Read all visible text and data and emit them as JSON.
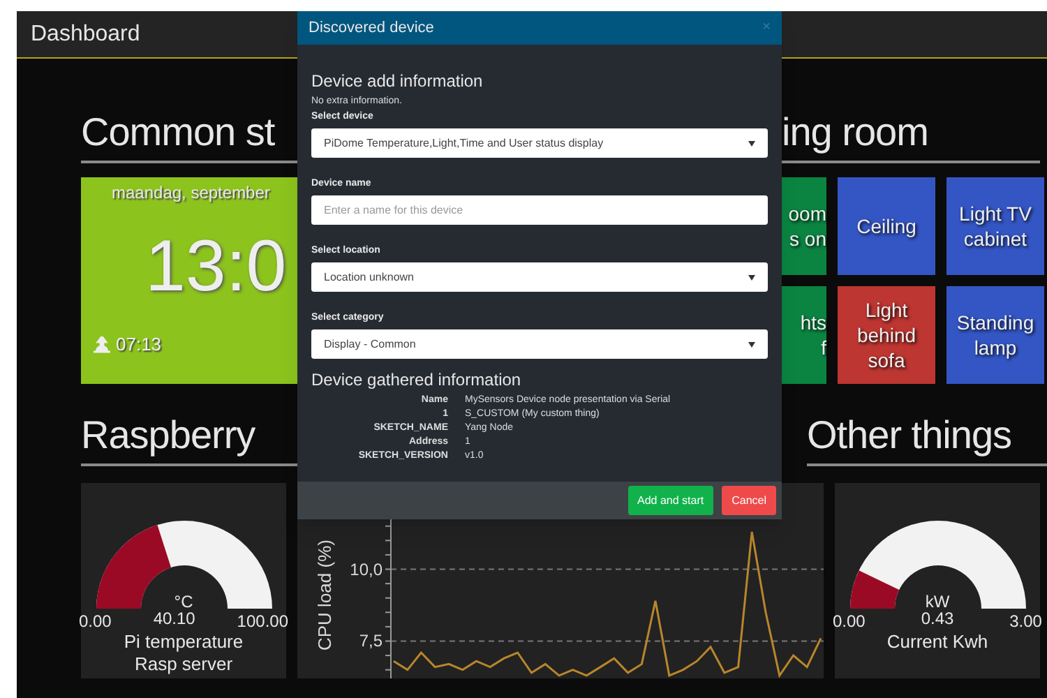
{
  "header": {
    "title": "Dashboard"
  },
  "common_section": {
    "title": "Common st",
    "clock": {
      "date": "maandag, september",
      "time": "13:0",
      "sunrise": "07:13"
    }
  },
  "living_room_section": {
    "title": "ing room",
    "tiles": [
      {
        "lines": [
          "oom",
          "s on"
        ],
        "color": "#0b8441",
        "partial": true
      },
      {
        "lines": [
          "Ceiling"
        ],
        "color": "#3456c4",
        "partial": false
      },
      {
        "lines": [
          "Light TV",
          "cabinet"
        ],
        "color": "#3456c4",
        "partial": false
      },
      {
        "lines": [
          "hts",
          "f"
        ],
        "color": "#0b8441",
        "partial": true
      },
      {
        "lines": [
          "Light",
          "behind",
          "sofa"
        ],
        "color": "#bd3631",
        "partial": false
      },
      {
        "lines": [
          "Standing",
          "lamp"
        ],
        "color": "#3456c4",
        "partial": false
      }
    ]
  },
  "raspberry_section": {
    "title": "Raspberry",
    "gauge": {
      "unit": "°C",
      "value": "40.10",
      "min": "0.00",
      "max": "100.00",
      "labels": [
        "Pi temperature",
        "Rasp server"
      ]
    },
    "cpu_chart": {
      "chart_data": {
        "type": "line",
        "ylabel": "CPU load (%)",
        "ylim": [
          6.2,
          13
        ],
        "yticks": [
          {
            "value": 7.5,
            "label": "7,5"
          },
          {
            "value": 10,
            "label": "10,0"
          }
        ],
        "series": [
          {
            "color": "#b8862b",
            "values": [
              6.8,
              6.5,
              7.1,
              6.6,
              6.7,
              6.5,
              6.8,
              6.6,
              6.9,
              7.1,
              6.4,
              6.7,
              6.3,
              6.5,
              6.3,
              6.6,
              6.9,
              6.4,
              6.7,
              8.9,
              6.3,
              6.5,
              6.8,
              7.3,
              6.4,
              6.6,
              11.3,
              8.5,
              6.3,
              7.0,
              6.6,
              7.6
            ]
          }
        ]
      }
    }
  },
  "other_section": {
    "title": "Other things",
    "gauge": {
      "unit": "kW",
      "value": "0.43",
      "min": "0.00",
      "max": "3.00",
      "labels": [
        "Current Kwh"
      ]
    }
  },
  "dialog": {
    "title": "Discovered device",
    "close": "×",
    "add_heading": "Device add information",
    "note": "No extra information.",
    "fields": [
      {
        "label": "Select device",
        "kind": "select",
        "value": "PiDome Temperature,Light,Time and User status display"
      },
      {
        "label": "Device name",
        "kind": "text",
        "placeholder": "Enter a name for this device"
      },
      {
        "label": "Select location",
        "kind": "select",
        "value": "Location unknown"
      },
      {
        "label": "Select category",
        "kind": "select",
        "value": "Display - Common"
      }
    ],
    "gathered_heading": "Device gathered information",
    "gathered": [
      {
        "key": "Name",
        "value": "MySensors Device node presentation via Serial"
      },
      {
        "key": "1",
        "value": "S_CUSTOM (My custom thing)"
      },
      {
        "key": "SKETCH_NAME",
        "value": "Yang Node"
      },
      {
        "key": "Address",
        "value": "1"
      },
      {
        "key": "SKETCH_VERSION",
        "value": "v1.0"
      }
    ],
    "buttons": [
      {
        "label": "Add and start",
        "kind": "primary"
      },
      {
        "label": "Cancel",
        "kind": "danger"
      }
    ]
  }
}
